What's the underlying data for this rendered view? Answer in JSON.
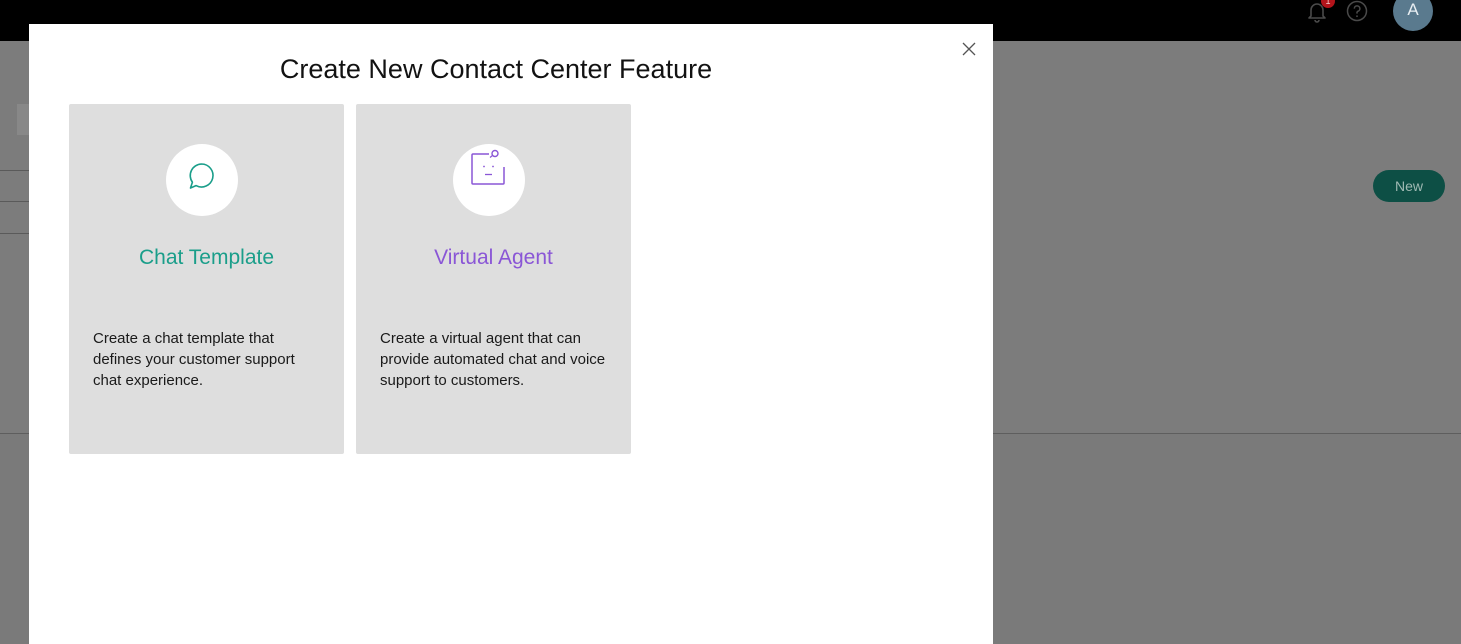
{
  "header": {
    "notification_count": "1",
    "avatar_initial": "A"
  },
  "background": {
    "new_button_label": "New"
  },
  "modal": {
    "title": "Create New Contact Center Feature",
    "cards": [
      {
        "title": "Chat Template",
        "description": "Create a chat template that defines your customer support chat experience.",
        "icon": "chat-bubble-icon",
        "accent": "#1a9e8a"
      },
      {
        "title": "Virtual Agent",
        "description": "Create a virtual agent that can provide automated chat and voice support to customers.",
        "icon": "virtual-agent-icon",
        "accent": "#8a56d6"
      }
    ]
  }
}
